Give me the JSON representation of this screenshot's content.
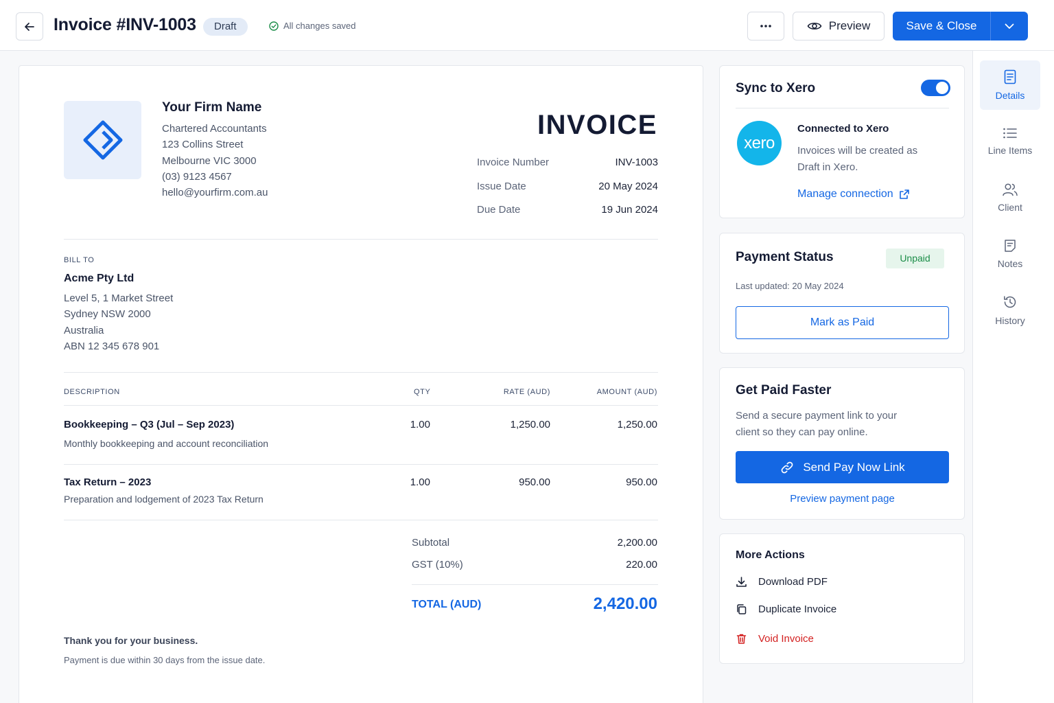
{
  "header": {
    "title": "Invoice #INV-1003",
    "status_badge": "Draft",
    "save_status": "All changes saved",
    "preview_label": "Preview",
    "save_close_label": "Save & Close"
  },
  "invoice": {
    "firm": {
      "name": "Your Firm Name",
      "lines": [
        "Chartered Accountants",
        "123 Collins Street",
        "Melbourne VIC 3000",
        "(03) 9123 4567",
        "hello@yourfirm.com.au"
      ]
    },
    "heading": "INVOICE",
    "meta": [
      {
        "label": "Invoice Number",
        "value": "INV-1003"
      },
      {
        "label": "Issue Date",
        "value": "20 May 2024"
      },
      {
        "label": "Due Date",
        "value": "19 Jun 2024"
      }
    ],
    "bill_to": {
      "label": "BILL TO",
      "name": "Acme Pty Ltd",
      "lines": [
        "Level 5, 1 Market Street",
        "Sydney NSW 2000",
        "Australia",
        "ABN 12 345 678 901"
      ]
    },
    "columns": {
      "description": "DESCRIPTION",
      "qty": "QTY",
      "rate": "RATE (AUD)",
      "amount": "AMOUNT (AUD)"
    },
    "items": [
      {
        "title": "Bookkeeping – Q3 (Jul – Sep 2023)",
        "description": "Monthly bookkeeping and account reconciliation",
        "qty": "1.00",
        "rate": "1,250.00",
        "amount": "1,250.00"
      },
      {
        "title": "Tax Return – 2023",
        "description": "Preparation and lodgement of 2023 Tax Return",
        "qty": "1.00",
        "rate": "950.00",
        "amount": "950.00"
      }
    ],
    "subtotal": {
      "label": "Subtotal",
      "value": "2,200.00"
    },
    "gst": {
      "label": "GST (10%)",
      "value": "220.00"
    },
    "total": {
      "label": "TOTAL (AUD)",
      "value": "2,420.00"
    },
    "footer": {
      "thanks": "Thank you for your business.",
      "terms": "Payment is due within 30 days from the issue date."
    }
  },
  "sync": {
    "title": "Sync to Xero",
    "enabled": true,
    "logo_text": "xero",
    "connected_title": "Connected to Xero",
    "connected_desc_1": "Invoices will be created as",
    "connected_desc_2": "Draft in Xero.",
    "manage_label": "Manage connection"
  },
  "payment": {
    "title": "Payment Status",
    "status": "Unpaid",
    "last_updated": "Last updated: 20 May 2024",
    "mark_paid_label": "Mark as Paid"
  },
  "get_paid": {
    "title": "Get Paid Faster",
    "desc_1": "Send a secure payment link to your",
    "desc_2": "client so they can pay online.",
    "send_label": "Send Pay Now Link",
    "preview_label": "Preview payment page"
  },
  "more_actions": {
    "title": "More Actions",
    "download": "Download PDF",
    "duplicate": "Duplicate Invoice",
    "void": "Void Invoice"
  },
  "rail": {
    "items": [
      {
        "label": "Details",
        "icon": "document-icon",
        "active": true
      },
      {
        "label": "Line Items",
        "icon": "list-icon",
        "active": false
      },
      {
        "label": "Client",
        "icon": "users-icon",
        "active": false
      },
      {
        "label": "Notes",
        "icon": "note-icon",
        "active": false
      },
      {
        "label": "History",
        "icon": "history-icon",
        "active": false
      }
    ]
  },
  "colors": {
    "accent": "#1467e3",
    "danger": "#d32020",
    "success": "#1b8d48",
    "xero": "#13b5ea"
  }
}
